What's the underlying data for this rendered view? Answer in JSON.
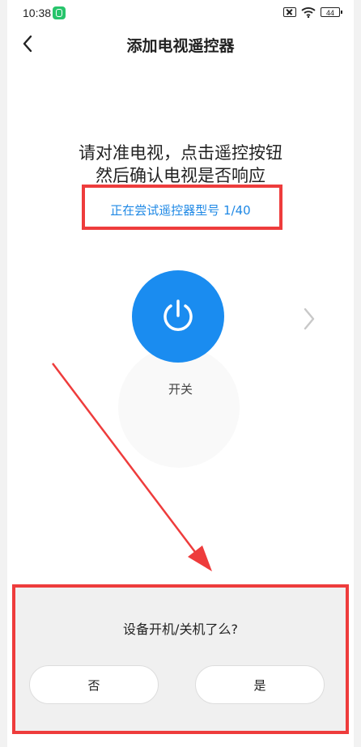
{
  "status_bar": {
    "time": "10:38",
    "battery": "44"
  },
  "header": {
    "title": "添加电视遥控器"
  },
  "instructions": {
    "line1": "请对准电视，点击遥控按钮",
    "line2": "然后确认电视是否响应",
    "model_progress": "正在尝试遥控器型号 1/40"
  },
  "remote": {
    "power_label": "开关"
  },
  "dialog": {
    "question": "设备开机/关机了么?",
    "no_label": "否",
    "yes_label": "是"
  },
  "colors": {
    "accent_blue": "#1a8cf0",
    "link_blue": "#1e88e5",
    "highlight_red": "#ee3c3c",
    "status_badge_green": "#27c46b"
  }
}
